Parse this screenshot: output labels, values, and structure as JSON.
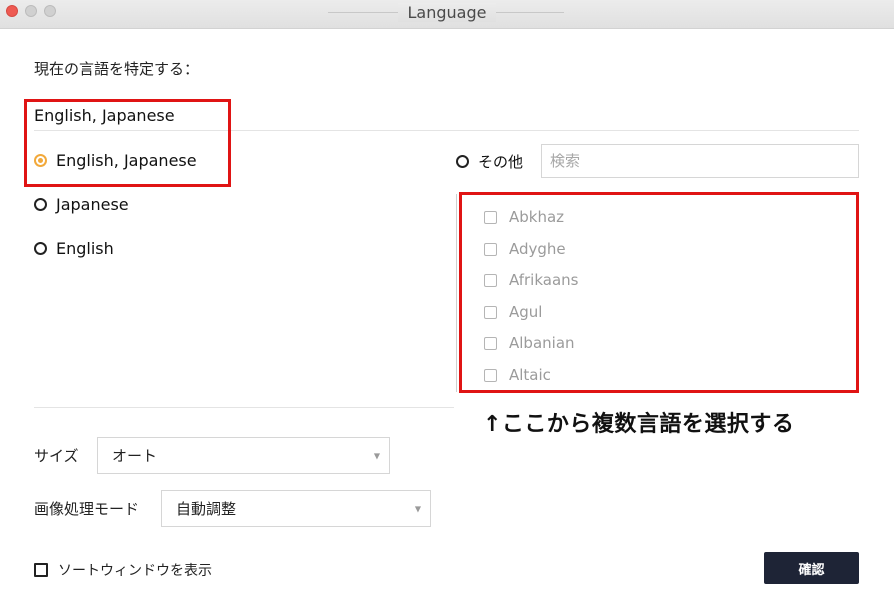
{
  "window": {
    "title": "Language"
  },
  "heading": "現在の言語を特定する：",
  "current_languages": "English, Japanese",
  "language_options": [
    {
      "label": "English, Japanese",
      "selected": true
    },
    {
      "label": "Japanese",
      "selected": false
    },
    {
      "label": "English",
      "selected": false
    }
  ],
  "other": {
    "label": "その他",
    "search_placeholder": "検索"
  },
  "other_languages": [
    "Abkhaz",
    "Adyghe",
    "Afrikaans",
    "Agul",
    "Albanian",
    "Altaic"
  ],
  "annotation": "↑ここから複数言語を選択する",
  "size": {
    "label": "サイズ",
    "value": "オート"
  },
  "processing_mode": {
    "label": "画像処理モード",
    "value": "自動調整"
  },
  "sort_window": {
    "label": "ソートウィンドウを表示",
    "checked": false
  },
  "confirm_label": "確認",
  "colors": {
    "accent": "#f2a93b",
    "highlight": "#e01414",
    "button_bg": "#1e2436"
  }
}
